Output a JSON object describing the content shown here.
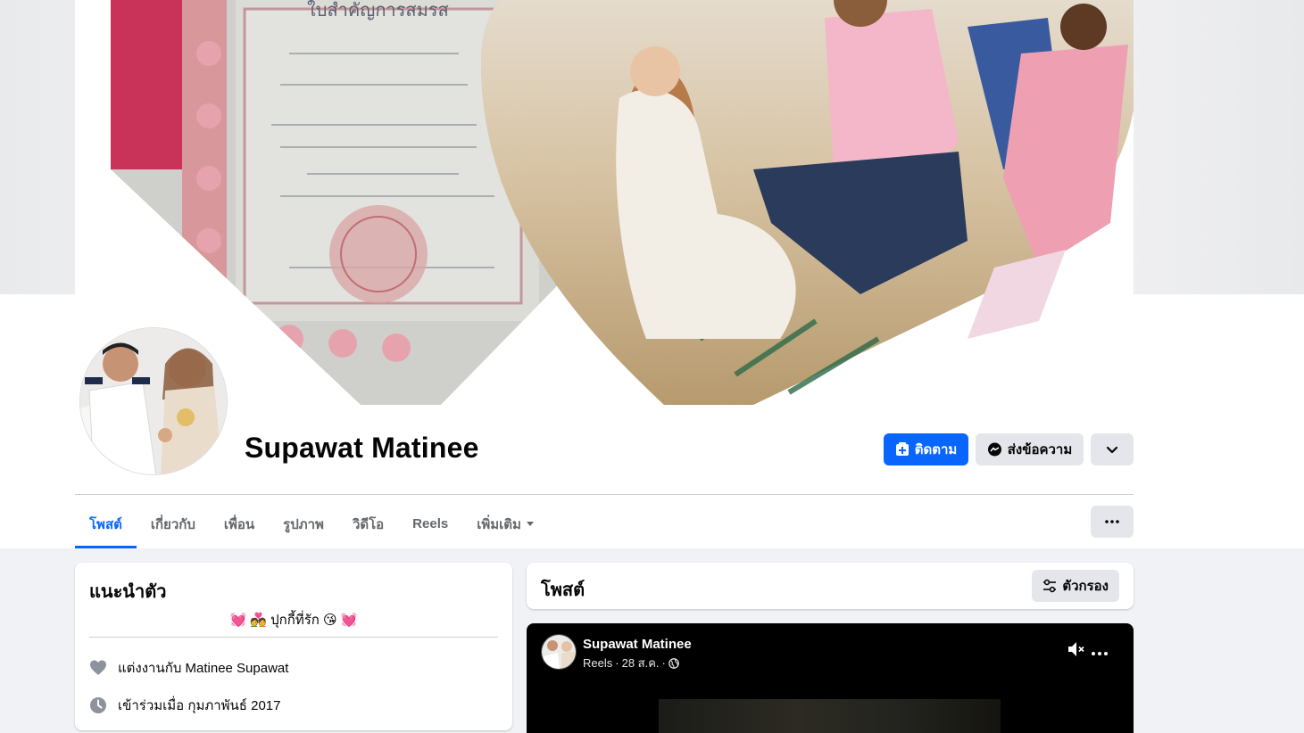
{
  "profile": {
    "name": "Supawat Matinee"
  },
  "actions": {
    "follow_label": "ติดตาม",
    "message_label": "ส่งข้อความ"
  },
  "tabs": [
    {
      "label": "โพสต์",
      "active": true
    },
    {
      "label": "เกี่ยวกับ"
    },
    {
      "label": "เพื่อน"
    },
    {
      "label": "รูปภาพ"
    },
    {
      "label": "วิดีโอ"
    },
    {
      "label": "Reels"
    },
    {
      "label": "เพิ่มเติม"
    }
  ],
  "intro": {
    "title": "แนะนำตัว",
    "bio": "💓 💑 ปุกกี้ที่รัก 😘 💓",
    "married_prefix": "แต่งงานกับ",
    "married_to": "Matinee Supawat",
    "joined": "เข้าร่วมเมื่อ กุมภาพันธ์ 2017"
  },
  "posts": {
    "title": "โพสต์",
    "filter_label": "ตัวกรอง"
  },
  "reel_post": {
    "author": "Supawat Matinee",
    "type": "Reels",
    "date": "28 ส.ค.",
    "separator": "·"
  },
  "colors": {
    "accent": "#0866ff",
    "button_gray": "#e4e6eb",
    "page_bg": "#f0f2f5"
  }
}
